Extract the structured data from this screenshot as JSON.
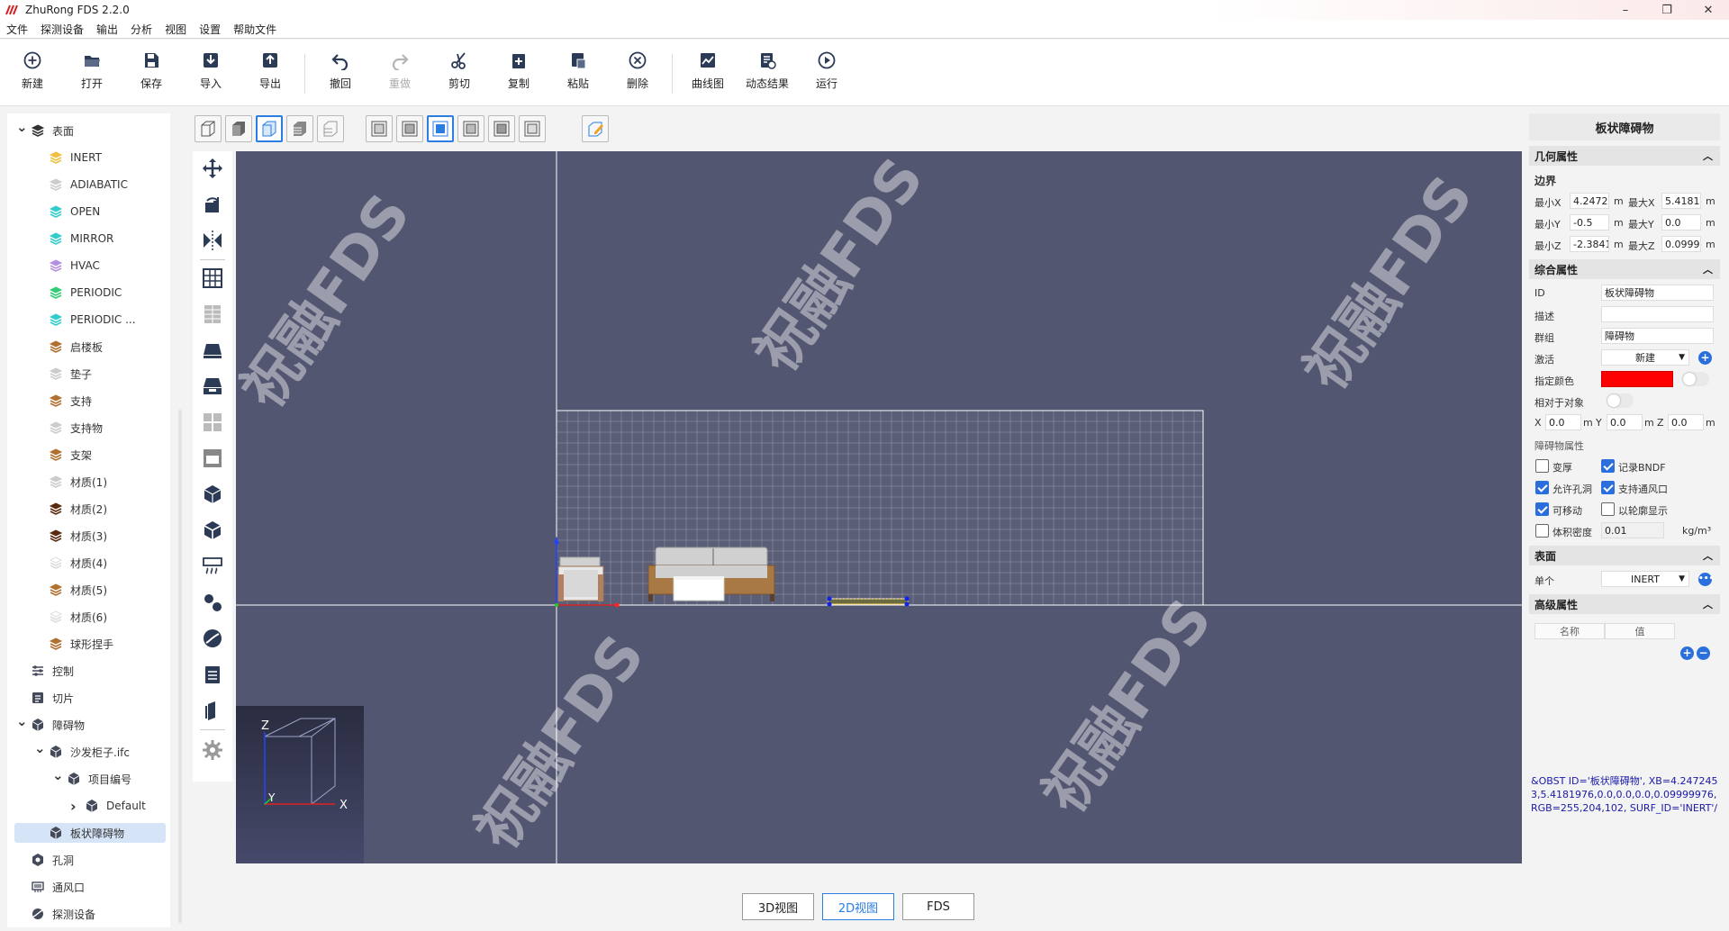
{
  "app": {
    "title": "ZhuRong FDS 2.2.0"
  },
  "menu": [
    "文件",
    "探测设备",
    "输出",
    "分析",
    "视图",
    "设置",
    "帮助文件"
  ],
  "toolbar": [
    {
      "label": "新建",
      "icon": "plus-circle-icon"
    },
    {
      "label": "打开",
      "icon": "folder-open-icon"
    },
    {
      "label": "保存",
      "icon": "save-icon"
    },
    {
      "label": "导入",
      "icon": "import-icon"
    },
    {
      "label": "导出",
      "icon": "export-icon"
    },
    {
      "label": "撤回",
      "icon": "undo-icon"
    },
    {
      "label": "重做",
      "icon": "redo-icon"
    },
    {
      "label": "剪切",
      "icon": "scissors-icon"
    },
    {
      "label": "复制",
      "icon": "copy-icon"
    },
    {
      "label": "粘贴",
      "icon": "paste-icon"
    },
    {
      "label": "删除",
      "icon": "delete-circle-icon"
    },
    {
      "label": "曲线图",
      "icon": "line-chart-icon"
    },
    {
      "label": "动态结果",
      "icon": "dynamic-result-icon"
    },
    {
      "label": "运行",
      "icon": "play-icon"
    }
  ],
  "tree": {
    "items": [
      {
        "label": "表面",
        "level": 0,
        "expanded": true,
        "color": "#333333"
      },
      {
        "label": "INERT",
        "level": 1,
        "color": "#f0c040"
      },
      {
        "label": "ADIABATIC",
        "level": 1,
        "color": "#cccccc"
      },
      {
        "label": "OPEN",
        "level": 1,
        "color": "#33cccc"
      },
      {
        "label": "MIRROR",
        "level": 1,
        "color": "#33cccc"
      },
      {
        "label": "HVAC",
        "level": 1,
        "color": "#b38fe0"
      },
      {
        "label": "PERIODIC",
        "level": 1,
        "color": "#33cc77"
      },
      {
        "label": "PERIODIC ...",
        "level": 1,
        "color": "#33cccc"
      },
      {
        "label": "启楼板",
        "level": 1,
        "color": "#b07030"
      },
      {
        "label": "垫子",
        "level": 1,
        "color": "#cccccc"
      },
      {
        "label": "支持",
        "level": 1,
        "color": "#b07030"
      },
      {
        "label": "支持物",
        "level": 1,
        "color": "#cccccc"
      },
      {
        "label": "支架",
        "level": 1,
        "color": "#b07030"
      },
      {
        "label": "材质(1)",
        "level": 1,
        "color": "#cccccc"
      },
      {
        "label": "材质(2)",
        "level": 1,
        "color": "#5a2a10"
      },
      {
        "label": "材质(3)",
        "level": 1,
        "color": "#5a2a10"
      },
      {
        "label": "材质(4)",
        "level": 1,
        "color": "#ffffff"
      },
      {
        "label": "材质(5)",
        "level": 1,
        "color": "#b07030"
      },
      {
        "label": "材质(6)",
        "level": 1,
        "color": "#ffffff"
      },
      {
        "label": "球形捏手",
        "level": 1,
        "color": "#b07030"
      },
      {
        "label": "控制",
        "level": 0,
        "icon": "control-icon"
      },
      {
        "label": "切片",
        "level": 0,
        "icon": "slice-icon"
      },
      {
        "label": "障碍物",
        "level": 0,
        "expanded": true,
        "icon": "cube-icon"
      },
      {
        "label": "沙发柜子.ifc",
        "level": 1,
        "expanded": true,
        "icon": "cube-icon"
      },
      {
        "label": "项目编号",
        "level": 2,
        "expanded": true,
        "icon": "cube-icon"
      },
      {
        "label": "Default",
        "level": 3,
        "collapsed": true,
        "icon": "cube-icon"
      },
      {
        "label": "板状障碍物",
        "level": 1,
        "selected": true,
        "icon": "cube-icon"
      },
      {
        "label": "孔洞",
        "level": 0,
        "icon": "hole-icon"
      },
      {
        "label": "通风口",
        "level": 0,
        "icon": "vent-icon"
      },
      {
        "label": "探测设备",
        "level": 0,
        "icon": "detector-icon"
      }
    ]
  },
  "viewtabs": {
    "tab3d": "3D视图",
    "tab2d": "2D视图",
    "tabfds": "FDS"
  },
  "axes": {
    "z": "Z",
    "y": "Y",
    "x": "X"
  },
  "watermark": "祝融FDS",
  "panel": {
    "title": "板状障碍物",
    "geom": {
      "header": "几何属性",
      "bounds": "边界",
      "minx_label": "最小X",
      "minx": "4.2472",
      "maxx_label": "最大X",
      "maxx": "5.4181",
      "miny_label": "最小Y",
      "miny": "-0.5",
      "maxy_label": "最大Y",
      "maxy": "0.0",
      "minz_label": "最小Z",
      "minz": "-2.3841",
      "maxz_label": "最大Z",
      "maxz": "0.0999",
      "unit": "m"
    },
    "general": {
      "header": "综合属性",
      "id_label": "ID",
      "id": "板状障碍物",
      "desc_label": "描述",
      "desc": "",
      "group_label": "群组",
      "group": "障碍物",
      "activate_label": "激活",
      "activate": "新建",
      "color_label": "指定颜色",
      "color": "#ff0000",
      "relative_label": "相对于对象",
      "x_label": "X",
      "x": "0.0",
      "y_label": "Y",
      "y": "0.0",
      "z_label": "Z",
      "z": "0.0",
      "obst_props": "障碍物属性",
      "thicken": "变厚",
      "thicken_on": false,
      "bndf": "记录BNDF",
      "bndf_on": true,
      "holes": "允许孔洞",
      "holes_on": true,
      "vents": "支持通风口",
      "vents_on": true,
      "movable": "可移动",
      "movable_on": true,
      "outline": "以轮廓显示",
      "outline_on": false,
      "density": "体积密度",
      "density_on": false,
      "density_value": "0.01",
      "density_unit": "kg/m³"
    },
    "surface": {
      "header": "表面",
      "single_label": "单个",
      "single": "INERT"
    },
    "advanced": {
      "header": "高级属性",
      "col_name": "名称",
      "col_value": "值"
    },
    "fds_code": "&OBST ID='板状障碍物', XB=4.2472453,5.4181976,0.0,0.0,0.0,0.09999976, RGB=255,204,102, SURF_ID='INERT'/"
  }
}
